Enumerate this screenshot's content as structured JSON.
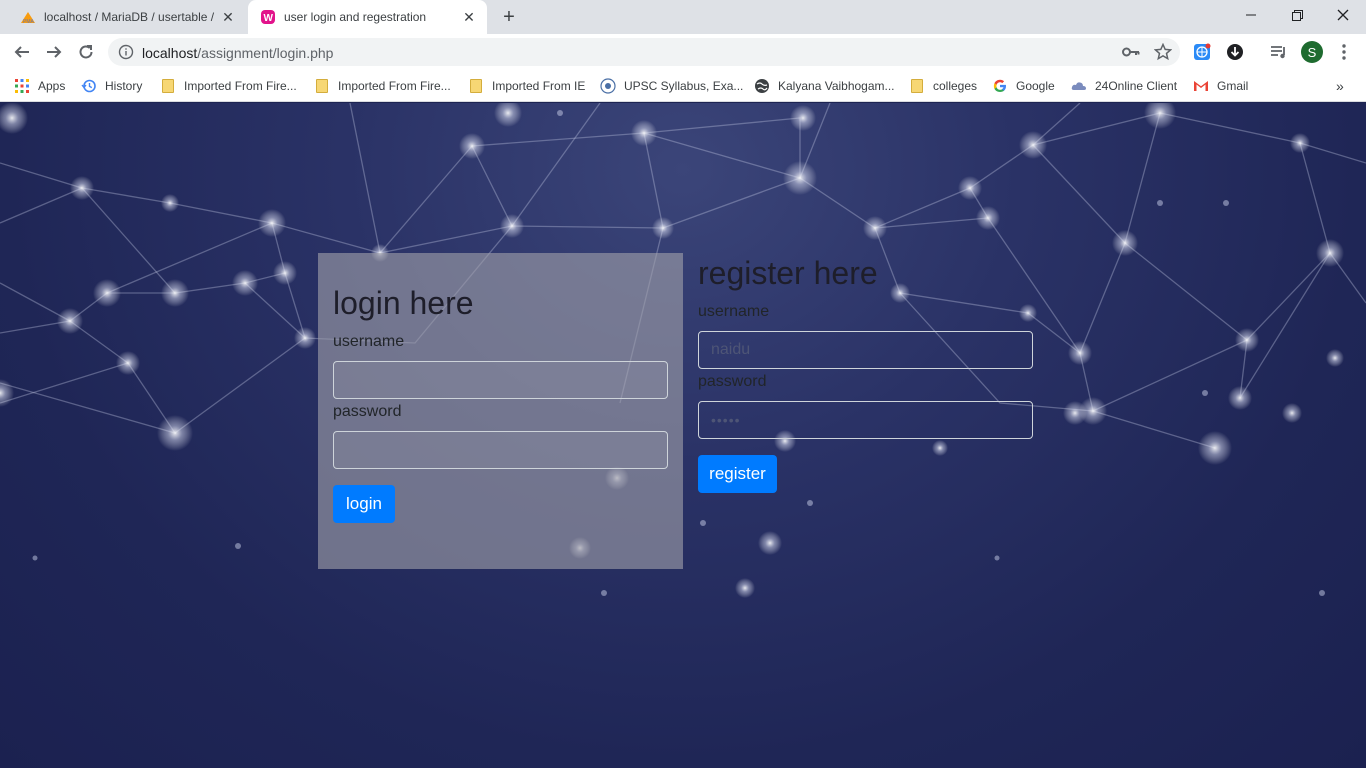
{
  "tabs": [
    {
      "title": "localhost / MariaDB / usertable / ...",
      "favicon": "pma-favicon"
    },
    {
      "title": "user login and regestration",
      "favicon": "wamp-favicon"
    }
  ],
  "toolbar": {
    "url_host": "localhost",
    "url_path": "/assignment/login.php",
    "profile_initial": "S"
  },
  "bookmarks": [
    {
      "label": "Apps",
      "icon": "apps-grid-icon"
    },
    {
      "label": "History",
      "icon": "history-icon"
    },
    {
      "label": "Imported From Fire...",
      "icon": "folder-icon"
    },
    {
      "label": "Imported From Fire...",
      "icon": "folder-icon"
    },
    {
      "label": "Imported From IE",
      "icon": "folder-icon"
    },
    {
      "label": "UPSC Syllabus, Exa...",
      "icon": "upsc-icon"
    },
    {
      "label": "Kalyana Vaibhogam...",
      "icon": "globe-icon"
    },
    {
      "label": "colleges",
      "icon": "folder-icon"
    },
    {
      "label": "Google",
      "icon": "google-icon"
    },
    {
      "label": "24Online Client",
      "icon": "cloud-icon"
    },
    {
      "label": "Gmail",
      "icon": "gmail-icon"
    }
  ],
  "login": {
    "title": "login here",
    "username_label": "username",
    "password_label": "password",
    "username_value": "",
    "password_value": "",
    "button": "login"
  },
  "register": {
    "title": "register here",
    "username_label": "username",
    "password_label": "password",
    "username_value": "naidu",
    "password_value": "•••••",
    "button": "register"
  },
  "colors": {
    "primary": "#007bff",
    "page_bg": "#1f2656",
    "login_panel": "#a0a0aa"
  }
}
